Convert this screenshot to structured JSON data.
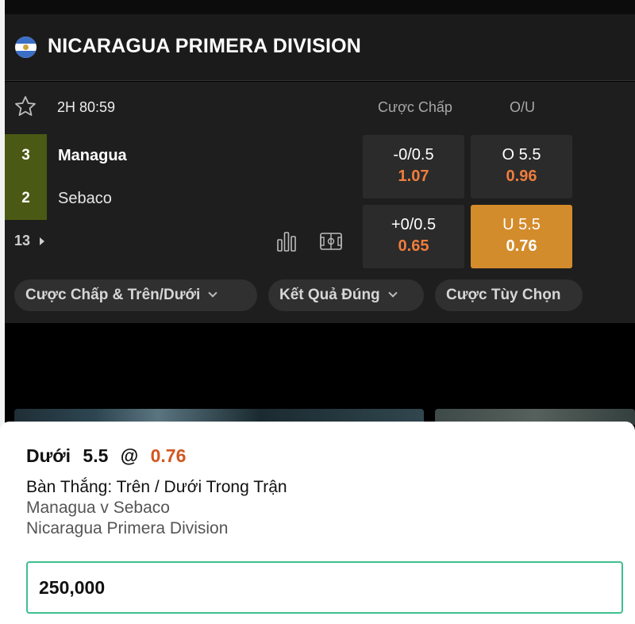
{
  "league": {
    "title": "NICARAGUA PRIMERA DIVISION",
    "flag_icon": "nicaragua-flag-icon",
    "flag_colors": [
      "#3b6fc5",
      "#ffffff",
      "#c9a33b"
    ]
  },
  "match": {
    "time": "2H 80:59",
    "home": {
      "name": "Managua",
      "score": "3"
    },
    "away": {
      "name": "Sebaco",
      "score": "2"
    },
    "more_markets": "13",
    "headers": {
      "handicap": "Cược Chấp",
      "over_under": "O/U"
    },
    "odds": [
      {
        "line": "-0/0.5",
        "price": "1.07",
        "selected": false
      },
      {
        "line": "O 5.5",
        "price": "0.96",
        "selected": false
      },
      {
        "line": "+0/0.5",
        "price": "0.65",
        "selected": false
      },
      {
        "line": "U 5.5",
        "price": "0.76",
        "selected": true
      }
    ],
    "filters": [
      "Cược Chấp & Trên/Dưới",
      "Kết Quả Đúng",
      "Cược Tùy Chọn"
    ]
  },
  "betslip": {
    "selection": "Dưới",
    "line": "5.5",
    "at": "@",
    "price": "0.76",
    "market": "Bàn Thắng: Trên / Dưới Trong Trận",
    "fixture": "Managua v Sebaco",
    "competition": "Nicaragua Primera Division",
    "stake": "250,000"
  },
  "colors": {
    "accent_orange": "#f07d3c",
    "selected_odd": "#d38c2c",
    "score_bg": "#4a5a14",
    "stake_border": "#3fbf8e"
  }
}
